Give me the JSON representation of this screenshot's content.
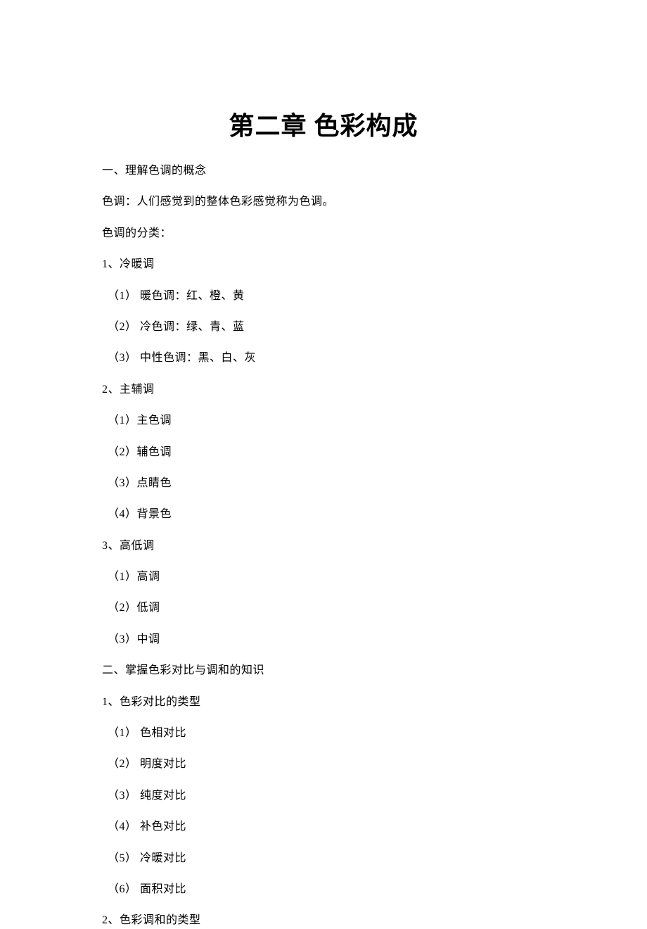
{
  "title": "第二章  色彩构成",
  "lines": [
    "一、理解色调的概念",
    "色调：人们感觉到的整体色彩感觉称为色调。",
    "色调的分类：",
    "1、冷暖调",
    "（1）  暖色调：红、橙、黄",
    "（2）  冷色调：绿、青、蓝",
    "（3）  中性色调：黑、白、灰",
    "2、主辅调",
    "（1）主色调",
    "（2）辅色调",
    "（3）点睛色",
    "（4）背景色",
    "3、高低调",
    "（1）高调",
    "（2）低调",
    "（3）中调",
    "二、掌握色彩对比与调和的知识",
    "1、色彩对比的类型",
    "（1）  色相对比",
    "（2）  明度对比",
    "（3）  纯度对比",
    "（4）  补色对比",
    "（5）  冷暖对比",
    "（6）  面积对比",
    "2、色彩调和的类型"
  ],
  "indents": [
    0,
    0,
    0,
    0,
    1,
    1,
    1,
    0,
    1,
    1,
    1,
    1,
    0,
    1,
    1,
    1,
    0,
    0,
    1,
    1,
    1,
    1,
    1,
    1,
    0
  ]
}
